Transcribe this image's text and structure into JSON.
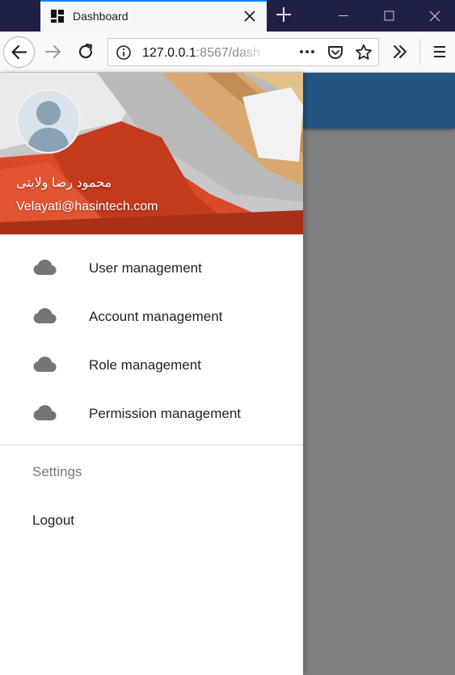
{
  "browser": {
    "tab": {
      "title": "Dashboard"
    },
    "url": {
      "host": "127.0.0.1",
      "rest": ":8567/dash"
    }
  },
  "drawer": {
    "user": {
      "name": "محمود رضا ولایتی",
      "email": "Velayati@hasintech.com"
    },
    "menu": [
      {
        "label": "User management",
        "icon": "cloud-icon"
      },
      {
        "label": "Account management",
        "icon": "cloud-icon"
      },
      {
        "label": "Role management",
        "icon": "cloud-icon"
      },
      {
        "label": "Permission management",
        "icon": "cloud-icon"
      }
    ],
    "subheader": "Settings",
    "logout": "Logout"
  },
  "colors": {
    "titlebar": "#1e2143",
    "appbar": "#22557f",
    "overlay": "#808080",
    "icon": "#757575"
  }
}
